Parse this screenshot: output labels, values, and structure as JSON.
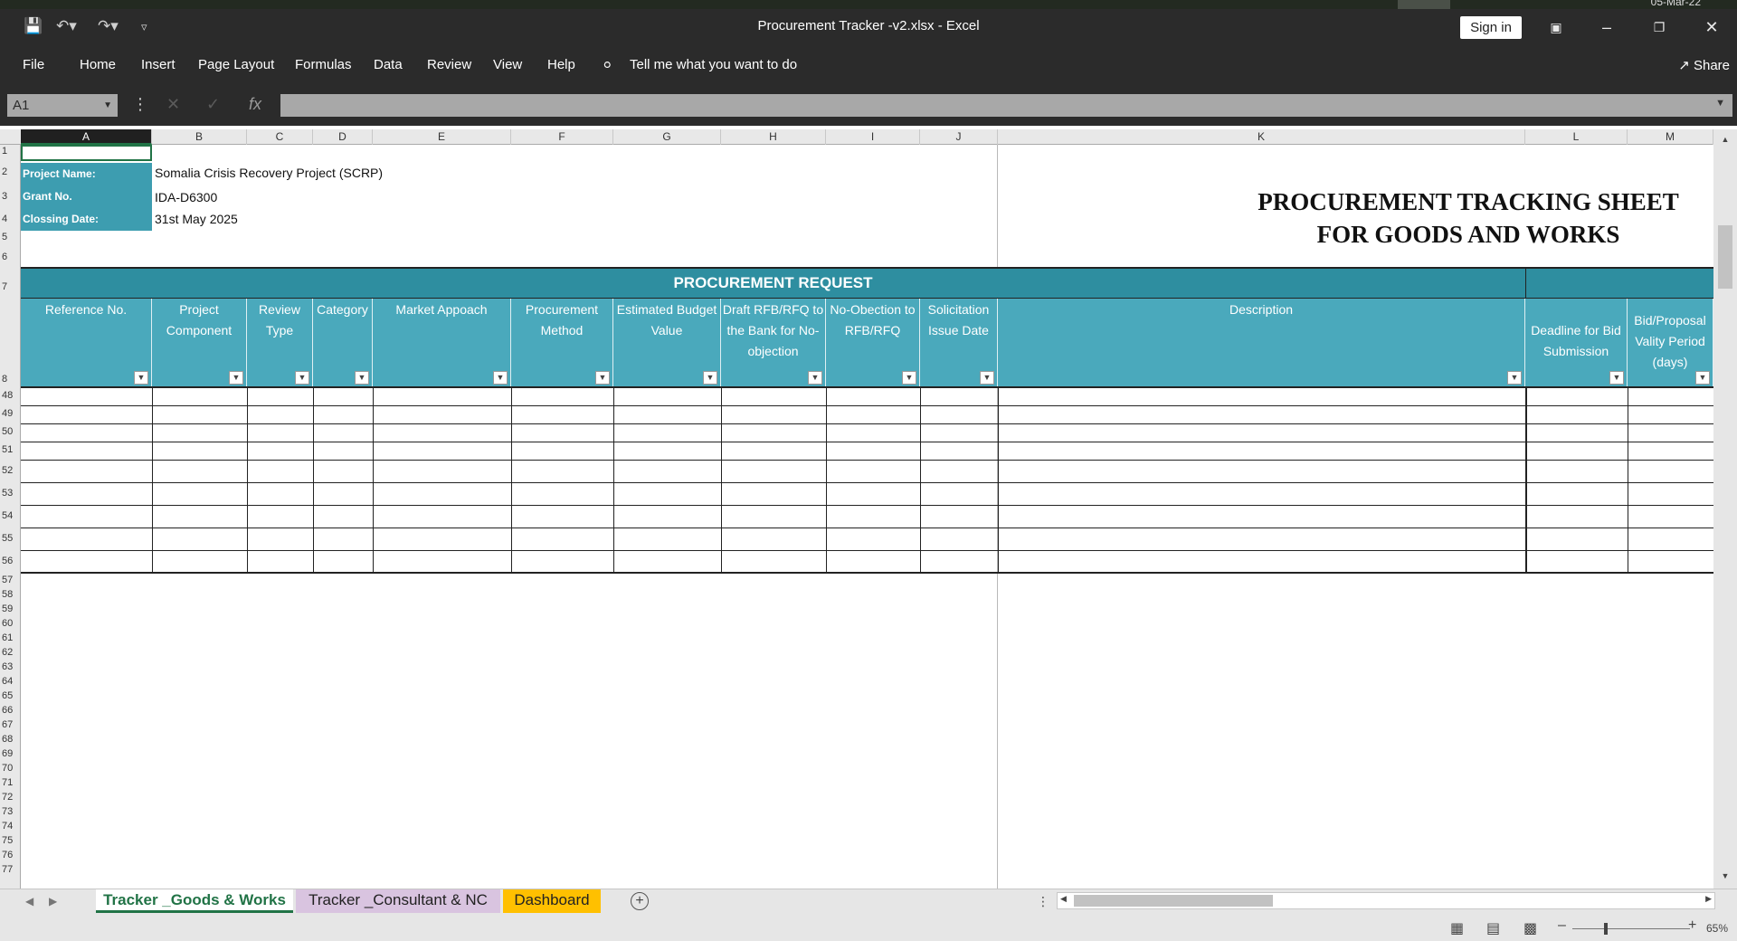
{
  "window": {
    "title": "Procurement Tracker -v2.xlsx  -  Excel",
    "clock": "05-Mar-22",
    "sign_in": "Sign in"
  },
  "ribbon": {
    "tabs": [
      "File",
      "Home",
      "Insert",
      "Page Layout",
      "Formulas",
      "Data",
      "Review",
      "View",
      "Help"
    ],
    "tell_me": "Tell me what you want to do",
    "share": "Share"
  },
  "formula_bar": {
    "name_box": "A1",
    "fx": "fx",
    "content": ""
  },
  "columns": [
    "A",
    "B",
    "C",
    "D",
    "E",
    "F",
    "G",
    "H",
    "I",
    "J",
    "K",
    "L",
    "M"
  ],
  "rows": [
    "1",
    "2",
    "3",
    "4",
    "5",
    "6",
    "7",
    "8",
    "48",
    "49",
    "50",
    "51",
    "52",
    "53",
    "54",
    "55",
    "56",
    "57",
    "58",
    "59",
    "60",
    "61",
    "62",
    "63",
    "64",
    "65",
    "66",
    "67",
    "68",
    "69",
    "70",
    "71",
    "72",
    "73",
    "74",
    "75",
    "76",
    "77"
  ],
  "info": {
    "project_label": "Project Name:",
    "project_value": "Somalia Crisis Recovery Project (SCRP)",
    "grant_label": "Grant No.",
    "grant_value": "IDA-D6300",
    "closing_label": "Clossing Date:",
    "closing_value": "31st May 2025"
  },
  "sheet_title": {
    "line1": "PROCUREMENT TRACKING SHEET",
    "line2": "FOR GOODS AND WORKS"
  },
  "band": "PROCUREMENT REQUEST",
  "table_headers": [
    "Reference No.",
    "Project Component",
    "Review Type",
    "Category",
    "Market Appoach",
    "Procurement Method",
    "Estimated Budget Value",
    "Draft RFB/RFQ to the Bank for No-objection",
    "No-Obection to RFB/RFQ",
    "Solicitation Issue Date",
    "Description",
    "Deadline for Bid Submission",
    "Bid/Proposal Vality Period (days)"
  ],
  "sheet_tabs": [
    "Tracker _Goods & Works",
    "Tracker _Consultant & NC",
    "Dashboard"
  ],
  "status": {
    "zoom": "65%"
  },
  "colors": {
    "band": "#2e8ea0",
    "header": "#4aa9bc",
    "label": "#3d9db0",
    "excel_green": "#217346",
    "tab_consultant": "#d9c4e0",
    "tab_dashboard": "#ffc000"
  }
}
